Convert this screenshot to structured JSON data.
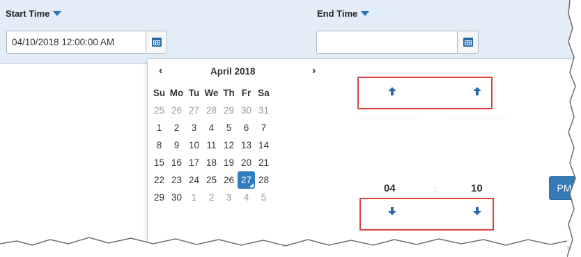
{
  "start": {
    "label": "Start Time",
    "value": "04/10/2018 12:00:00 AM"
  },
  "end": {
    "label": "End Time",
    "value": ""
  },
  "calendar": {
    "prev": "‹",
    "next": "›",
    "month_title": "April 2018",
    "weekdays": [
      "Su",
      "Mo",
      "Tu",
      "We",
      "Th",
      "Fr",
      "Sa"
    ],
    "weeks": [
      [
        "25",
        "26",
        "27",
        "28",
        "29",
        "30",
        "31"
      ],
      [
        "1",
        "2",
        "3",
        "4",
        "5",
        "6",
        "7"
      ],
      [
        "8",
        "9",
        "10",
        "11",
        "12",
        "13",
        "14"
      ],
      [
        "15",
        "16",
        "17",
        "18",
        "19",
        "20",
        "21"
      ],
      [
        "22",
        "23",
        "24",
        "25",
        "26",
        "27",
        "28"
      ],
      [
        "29",
        "30",
        "1",
        "2",
        "3",
        "4",
        "5"
      ]
    ],
    "selected_day": "27"
  },
  "time": {
    "hour": "04",
    "separator": ":",
    "minute": "10",
    "meridiem": "PM"
  },
  "colors": {
    "accent": "#337ab7",
    "highlight_box": "#e0413f",
    "header_band": "#e3edf7"
  }
}
